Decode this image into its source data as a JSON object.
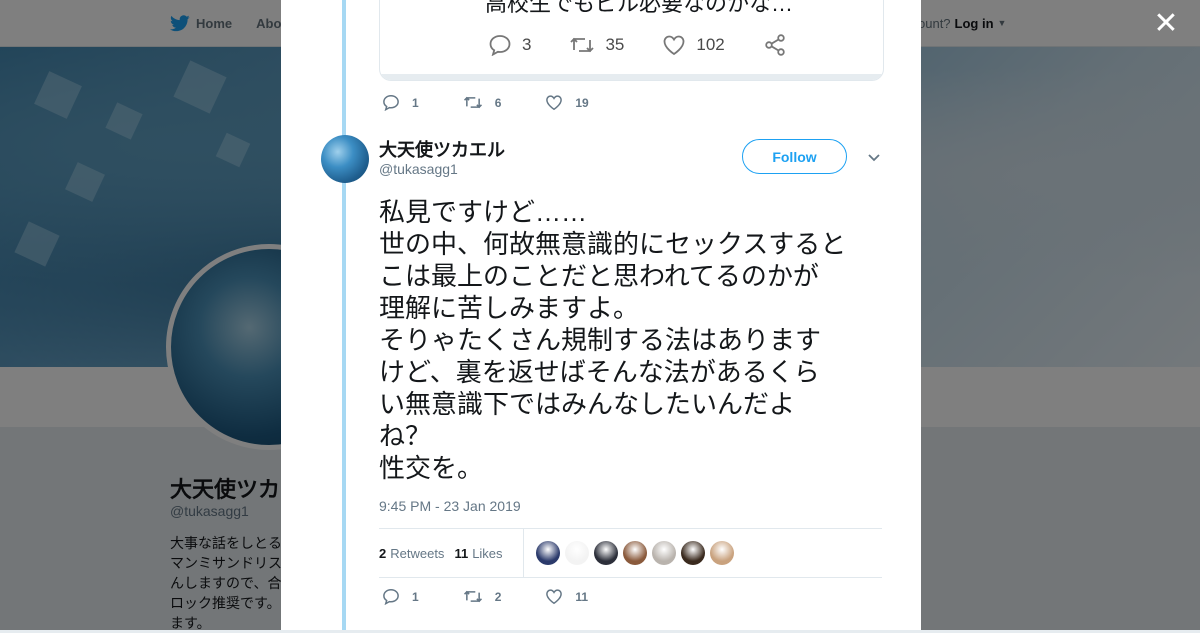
{
  "background_page": {
    "nav": {
      "home_label": "Home",
      "about_label": "Abo",
      "account_prompt": "ccount?",
      "login_label": "Log in"
    },
    "profile": {
      "name": "大天使ツカエ",
      "handle": "@tukasagg1",
      "bio_lines": [
        "大事な話をしとる",
        "マンミサンドリス",
        "んしますので、合",
        "ロック推奨です。",
        "ます。"
      ]
    }
  },
  "modal": {
    "quoted_card": {
      "text": "高校生でもピル必要なのかな…",
      "replies": "3",
      "retweets": "35",
      "likes": "102"
    },
    "previous_tweet_actions": {
      "replies": "1",
      "retweets": "6",
      "likes": "19"
    },
    "tweet": {
      "display_name": "大天使ツカエル",
      "handle": "@tukasagg1",
      "follow_label": "Follow",
      "body_lines": [
        "私見ですけど……",
        "世の中、何故無意識的にセックスすると",
        "こは最上のことだと思われてるのかが",
        "理解に苦しみますよ。",
        "そりゃたくさん規制する法はあります",
        "けど、裏を返せばそんな法があるくら",
        "い無意識下ではみんなしたいんだよ",
        "ね？",
        "性交を。"
      ],
      "timestamp": "9:45 PM - 23 Jan 2019",
      "retweet_count": "2",
      "retweet_label": "Retweets",
      "like_count": "11",
      "like_label": "Likes",
      "liker_colors": [
        "#2b3a6b",
        "#f3f3f3",
        "#2c2f3a",
        "#8a5a3c",
        "#b9b3ad",
        "#3a2a1e",
        "#c9a27e"
      ],
      "actions": {
        "replies": "1",
        "retweets": "2",
        "likes": "11"
      }
    }
  },
  "colors": {
    "accent": "#1da1f2",
    "thread_line": "#a6d8f3",
    "text": "#14171a",
    "secondary": "#657786"
  }
}
